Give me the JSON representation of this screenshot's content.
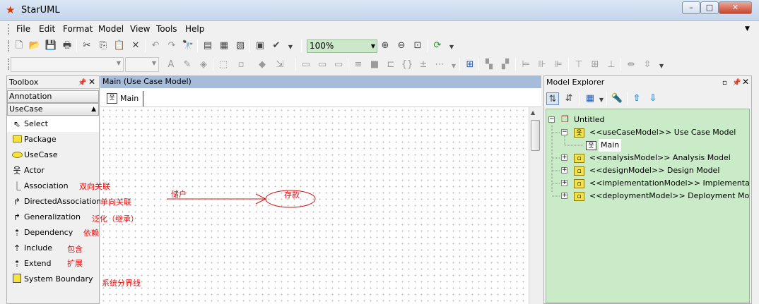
{
  "window": {
    "title": "StarUML",
    "minimize_label": "–",
    "maximize_label": "□",
    "close_label": "✕"
  },
  "menu": {
    "items": [
      "File",
      "Edit",
      "Format",
      "Model",
      "View",
      "Tools",
      "Help"
    ]
  },
  "toolbar": {
    "zoom_value": "100%"
  },
  "toolbox": {
    "title": "Toolbox",
    "categories": [
      "Annotation",
      "UseCase"
    ],
    "items": [
      {
        "label": "Select",
        "icon": "cursor-arrow-icon"
      },
      {
        "label": "Package",
        "icon": "package-icon"
      },
      {
        "label": "UseCase",
        "icon": "usecase-icon"
      },
      {
        "label": "Actor",
        "icon": "actor-icon"
      },
      {
        "label": "Association",
        "icon": "association-icon"
      },
      {
        "label": "DirectedAssociation",
        "icon": "directed-association-icon"
      },
      {
        "label": "Generalization",
        "icon": "generalization-icon"
      },
      {
        "label": "Dependency",
        "icon": "dependency-icon"
      },
      {
        "label": "Include",
        "icon": "include-icon"
      },
      {
        "label": "Extend",
        "icon": "extend-icon"
      },
      {
        "label": "System Boundary",
        "icon": "system-boundary-icon"
      }
    ]
  },
  "annotations": [
    "双向关联",
    "单向关联",
    "泛化（继承）",
    "依赖",
    "包含",
    "扩展",
    "系统分界线"
  ],
  "diagram": {
    "header": "Main (Use Case Model)",
    "tab_label": "Main",
    "association_label": "储户",
    "usecase_label": "存款",
    "arrow_color": "#d01818"
  },
  "explorer": {
    "title": "Model Explorer",
    "root": "Untitled",
    "nodes": [
      "<<useCaseModel>> Use Case Model",
      "Main",
      "<<analysisModel>> Analysis Model",
      "<<designModel>> Design Model",
      "<<implementationModel>> Implementation Model",
      "<<deploymentModel>> Deployment Model"
    ],
    "tree_bg": "#c9ebc8"
  }
}
